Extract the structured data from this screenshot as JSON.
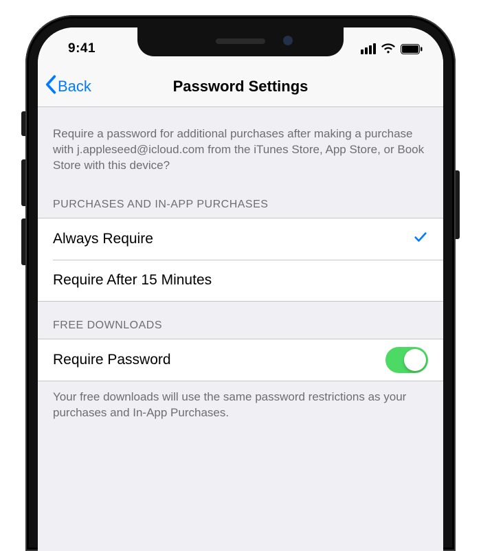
{
  "status": {
    "time": "9:41"
  },
  "nav": {
    "back_label": "Back",
    "title": "Password Settings"
  },
  "intro": "Require a password for additional purchases after making a purchase with j.appleseed@icloud.com from the iTunes Store, App Store, or Book Store with this device?",
  "purchases": {
    "header": "PURCHASES AND IN-APP PURCHASES",
    "options": [
      {
        "label": "Always Require",
        "selected": true
      },
      {
        "label": "Require After 15 Minutes",
        "selected": false
      }
    ]
  },
  "free": {
    "header": "FREE DOWNLOADS",
    "row_label": "Require Password",
    "toggle_on": true,
    "footer": "Your free downloads will use the same password restrictions as your purchases and In-App Purchases."
  }
}
